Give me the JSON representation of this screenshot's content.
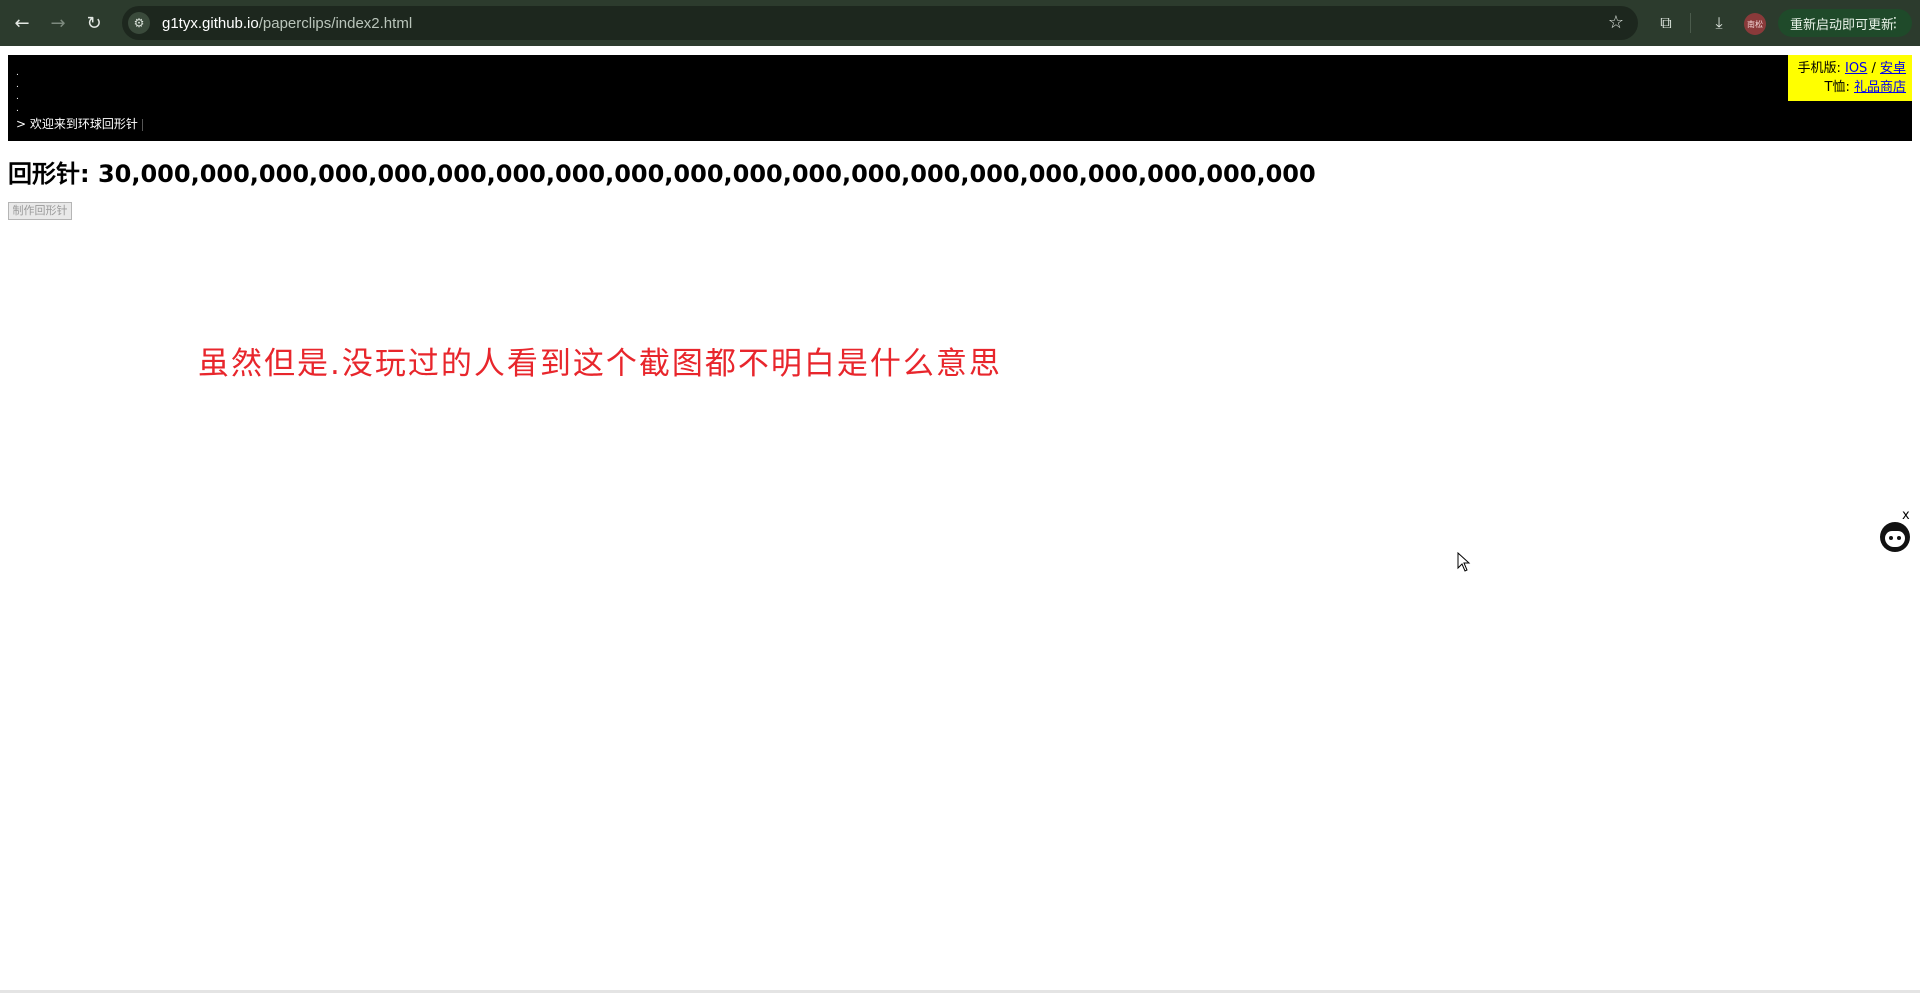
{
  "browser": {
    "back_icon": "arrow-left-icon",
    "forward_icon": "arrow-right-icon",
    "reload_icon": "reload-icon",
    "url_host": "g1tyx.github.io",
    "url_path": "/paperclips/index2.html",
    "bookmark_icon": "star-icon",
    "extensions_icon": "puzzle-icon",
    "download_icon": "download-icon",
    "profile_label": "南松",
    "update_button_label": "重新启动即可更新",
    "update_menu_icon": "⋮"
  },
  "console": {
    "dots": [
      ".",
      ".",
      ".",
      "."
    ],
    "line": "> 欢迎来到环球回形针"
  },
  "promo": {
    "mobile_label": "手机版:",
    "ios_link": "IOS",
    "separator": "/",
    "android_link": "安卓",
    "shirt_label": "T恤:",
    "shop_link": "礼品商店"
  },
  "game": {
    "clip_label": "回形针:",
    "clip_count": "30,000,000,000,000,000,000,000,000,000,000,000,000,000,000,000,000,000,000,000,000",
    "make_button_label": "制作回形针"
  },
  "annotation": {
    "text": "虽然但是.没玩过的人看到这个截图都不明白是什么意思",
    "color": "#e8262c"
  },
  "widget": {
    "close_label": "x",
    "icon": "face-avatar-icon"
  }
}
